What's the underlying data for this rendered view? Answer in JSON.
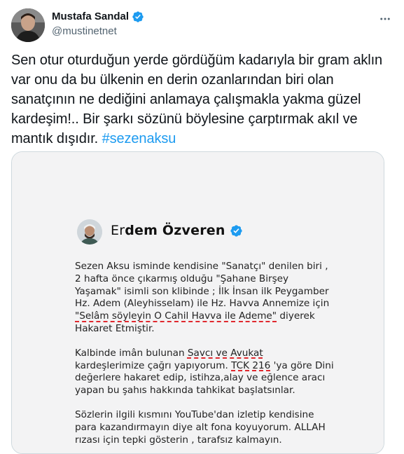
{
  "author": {
    "display_name": "Mustafa Sandal",
    "handle": "@mustinetnet",
    "avatar_icon": "user-avatar",
    "verified_icon": "verified-badge-icon"
  },
  "tweet": {
    "text": "Sen otur oturduğun yerde gördüğüm kadarıyla bir gram aklın var onu da bu ülkenin en derin ozanlarından biri olan sanatçının ne dediğini anlamaya çalışmakla yakma güzel kardeşim!.. Bir şarkı sözünü böylesine çarptırmak akıl ve mantık dışıdır. ",
    "hashtag": "#sezenaksu"
  },
  "media": {
    "screenshot": {
      "name_prefix": "Er",
      "name_rest": "dem Özveren",
      "para1_a": "Sezen Aksu isminde kendisine \"Sanatçı\" denilen biri , 2 hafta önce çıkarmış olduğu \"Şahane Birşey Yaşamak\" isimli son klibinde ; İlk İnsan ilk Peygamber Hz. Adem (Aleyhisselam) ile Hz. Havva Annemize için ",
      "para1_u1": "\"Selâm söyleyin O Cahil Havva ile",
      "para1_u2": "Ademe\"",
      "para1_b": " diyerek Hakaret Etmiştir.",
      "para2_a": "Kalbinde imân bulunan ",
      "para2_u1": "Savcı ve Avukat",
      "para2_b": " kardeşlerimize çağrı yapıyorum. ",
      "para2_u2": "TCK 216",
      "para2_c": " 'ya göre Dini değerlere hakaret edip, istihza,alay ve eğlence aracı yapan bu şahıs hakkında tahkikat başlatsınlar.",
      "para3": "Sözlerin ilgili kısmını YouTube'dan izletip kendisine para kazandırmayın diye alt fona koyuyorum. ALLAH rızası için tepki gösterin , tarafsız kalmayın."
    }
  },
  "colors": {
    "accent": "#1d9bf0",
    "text": "#0f1419",
    "secondary": "#536471",
    "underline": "#e0282e"
  }
}
